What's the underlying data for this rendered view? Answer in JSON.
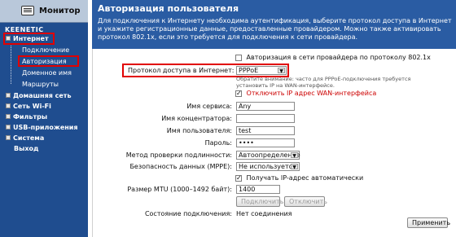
{
  "sidebar": {
    "monitor_label": "Монитор",
    "brand": "KEENETIC",
    "items": [
      {
        "label": "Интернет"
      },
      {
        "label": "Подключение"
      },
      {
        "label": "Авторизация"
      },
      {
        "label": "Доменное имя"
      },
      {
        "label": "Маршруты"
      },
      {
        "label": "Домашняя сеть"
      },
      {
        "label": "Сеть Wi-Fi"
      },
      {
        "label": "Фильтры"
      },
      {
        "label": "USB-приложения"
      },
      {
        "label": "Система"
      },
      {
        "label": "Выход"
      }
    ]
  },
  "header": {
    "title": "Авторизация пользователя",
    "description": "Для подключения к Интернету необходима аутентификация, выберите протокол доступа в Интернет и укажите регистрационные данные, предоставленные провайдером. Можно также активировать протокол 802.1x, если это требуется для подключения к сети провайдера."
  },
  "form": {
    "auth_8021x_label": "Авторизация в сети провайдера по протоколу 802.1x",
    "protocol_label": "Протокол доступа в Интернет:",
    "protocol_value": "PPPoE",
    "note": "Обратите внимание: часто для PPPoE-подключения требуется установить IP на WAN-интерфейсе.",
    "disable_wan_ip_label": "Отключить IP адрес WAN-интерфейса",
    "service_name_label": "Имя сервиса:",
    "service_name_value": "Any",
    "concentrator_label": "Имя концентратора:",
    "concentrator_value": "",
    "username_label": "Имя пользователя:",
    "username_value": "test",
    "password_label": "Пароль:",
    "password_value": "••••",
    "auth_method_label": "Метод проверки подлинности:",
    "auth_method_value": "Автоопределение",
    "security_label": "Безопасность данных (MPPE):",
    "security_value": "Не используется",
    "auto_ip_label": "Получать IP-адрес автоматически",
    "mtu_label": "Размер MTU (1000–1492 байт):",
    "mtu_value": "1400",
    "connect_button": "Подключить",
    "disconnect_button": "Отключить",
    "state_label": "Состояние подключения:",
    "state_value": "Нет соединения",
    "apply_button": "Применить"
  },
  "colors": {
    "sidebar_bg": "#1f4d8f",
    "header_bg": "#2a5ca3",
    "highlight_red": "#e10000"
  }
}
